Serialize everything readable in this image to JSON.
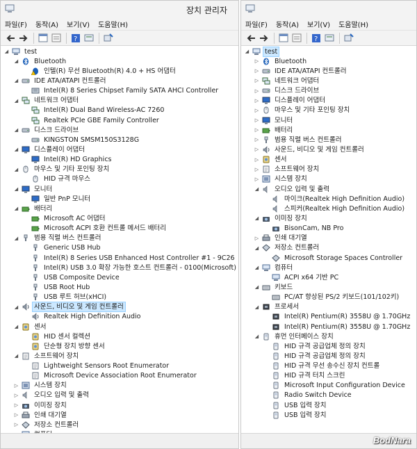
{
  "colors": {
    "selection": "#cce8ff",
    "titlebar": "#f3f3f3"
  },
  "left": {
    "title": "장치 관리자",
    "menu": [
      "파일(F)",
      "동작(A)",
      "보기(V)",
      "도움말(H)"
    ],
    "rows": [
      {
        "d": 0,
        "e": "down",
        "i": "computer",
        "t": "test"
      },
      {
        "d": 1,
        "e": "down",
        "i": "bluetooth",
        "t": "Bluetooth"
      },
      {
        "d": 2,
        "e": "",
        "i": "bluetooth-warn",
        "t": "인텔(R) 무선 Bluetooth(R) 4.0 + HS 어댑터"
      },
      {
        "d": 1,
        "e": "down",
        "i": "disk",
        "t": "IDE ATA/ATAPI 컨트롤러"
      },
      {
        "d": 2,
        "e": "",
        "i": "controller",
        "t": "Intel(R) 8 Series Chipset Family SATA AHCI Controller"
      },
      {
        "d": 1,
        "e": "down",
        "i": "network",
        "t": "네트워크 어댑터"
      },
      {
        "d": 2,
        "e": "",
        "i": "network",
        "t": "Intel(R) Dual Band Wireless-AC 7260"
      },
      {
        "d": 2,
        "e": "",
        "i": "network",
        "t": "Realtek PCIe GBE Family Controller"
      },
      {
        "d": 1,
        "e": "down",
        "i": "disk",
        "t": "디스크 드라이브"
      },
      {
        "d": 2,
        "e": "",
        "i": "disk",
        "t": "KINGSTON SMSM150S3128G"
      },
      {
        "d": 1,
        "e": "down",
        "i": "monitor",
        "t": "디스플레이 어댑터"
      },
      {
        "d": 2,
        "e": "",
        "i": "monitor",
        "t": "Intel(R) HD Graphics"
      },
      {
        "d": 1,
        "e": "down",
        "i": "mouse",
        "t": "마우스 및 기타 포인팅 장치"
      },
      {
        "d": 2,
        "e": "",
        "i": "mouse",
        "t": "HID 규격 마우스"
      },
      {
        "d": 1,
        "e": "down",
        "i": "monitor",
        "t": "모니터"
      },
      {
        "d": 2,
        "e": "",
        "i": "monitor",
        "t": "일반 PnP 모니터"
      },
      {
        "d": 1,
        "e": "down",
        "i": "battery",
        "t": "배터리"
      },
      {
        "d": 2,
        "e": "",
        "i": "battery",
        "t": "Microsoft AC 어댑터"
      },
      {
        "d": 2,
        "e": "",
        "i": "battery",
        "t": "Microsoft ACPI 호환 컨트롤 메서드 배터리"
      },
      {
        "d": 1,
        "e": "down",
        "i": "usb",
        "t": "범용 직렬 버스 컨트롤러"
      },
      {
        "d": 2,
        "e": "",
        "i": "usb",
        "t": "Generic USB Hub"
      },
      {
        "d": 2,
        "e": "",
        "i": "usb",
        "t": "Intel(R) 8 Series USB Enhanced Host Controller #1 - 9C26"
      },
      {
        "d": 2,
        "e": "",
        "i": "usb",
        "t": "Intel(R) USB 3.0 확장 가능한 호스트 컨트롤러 - 0100(Microsoft)"
      },
      {
        "d": 2,
        "e": "",
        "i": "usb",
        "t": "USB Composite Device"
      },
      {
        "d": 2,
        "e": "",
        "i": "usb",
        "t": "USB Root Hub"
      },
      {
        "d": 2,
        "e": "",
        "i": "usb",
        "t": "USB 루트 허브(xHCI)"
      },
      {
        "d": 1,
        "e": "down",
        "i": "speaker",
        "t": "사운드, 비디오 및 게임 컨트롤러",
        "sel": true
      },
      {
        "d": 2,
        "e": "",
        "i": "speaker",
        "t": "Realtek High Definition Audio"
      },
      {
        "d": 1,
        "e": "down",
        "i": "sensor",
        "t": "센서"
      },
      {
        "d": 2,
        "e": "",
        "i": "sensor",
        "t": "HID 센서 컬렉션"
      },
      {
        "d": 2,
        "e": "",
        "i": "sensor",
        "t": "단순형 장치 방향 센서"
      },
      {
        "d": 1,
        "e": "down",
        "i": "software",
        "t": "소프트웨어 장치"
      },
      {
        "d": 2,
        "e": "",
        "i": "software",
        "t": "Lightweight Sensors Root Enumerator"
      },
      {
        "d": 2,
        "e": "",
        "i": "software",
        "t": "Microsoft Device Association Root Enumerator"
      },
      {
        "d": 1,
        "e": "right",
        "i": "system",
        "t": "시스템 장치"
      },
      {
        "d": 1,
        "e": "right",
        "i": "audio",
        "t": "오디오 입력 및 출력"
      },
      {
        "d": 1,
        "e": "right",
        "i": "camera",
        "t": "이미징 장치"
      },
      {
        "d": 1,
        "e": "right",
        "i": "printer",
        "t": "인쇄 대기열"
      },
      {
        "d": 1,
        "e": "right",
        "i": "storage",
        "t": "저장소 컨트롤러"
      },
      {
        "d": 1,
        "e": "right",
        "i": "computer",
        "t": "컴퓨터"
      }
    ]
  },
  "right": {
    "menu": [
      "파일(F)",
      "동작(A)",
      "보기(V)",
      "도움말(H)"
    ],
    "rows": [
      {
        "d": 0,
        "e": "down",
        "i": "computer",
        "t": "test",
        "sel": true
      },
      {
        "d": 1,
        "e": "right",
        "i": "bluetooth",
        "t": "Bluetooth"
      },
      {
        "d": 1,
        "e": "right",
        "i": "disk",
        "t": "IDE ATA/ATAPI 컨트롤러"
      },
      {
        "d": 1,
        "e": "right",
        "i": "network",
        "t": "네트워크 어댑터"
      },
      {
        "d": 1,
        "e": "right",
        "i": "disk",
        "t": "디스크 드라이브"
      },
      {
        "d": 1,
        "e": "right",
        "i": "monitor",
        "t": "디스플레이 어댑터"
      },
      {
        "d": 1,
        "e": "right",
        "i": "mouse",
        "t": "마우스 및 기타 포인팅 장치"
      },
      {
        "d": 1,
        "e": "right",
        "i": "monitor",
        "t": "모니터"
      },
      {
        "d": 1,
        "e": "right",
        "i": "battery",
        "t": "배터리"
      },
      {
        "d": 1,
        "e": "right",
        "i": "usb",
        "t": "범용 직렬 버스 컨트롤러"
      },
      {
        "d": 1,
        "e": "right",
        "i": "speaker",
        "t": "사운드, 비디오 및 게임 컨트롤러"
      },
      {
        "d": 1,
        "e": "right",
        "i": "sensor",
        "t": "센서"
      },
      {
        "d": 1,
        "e": "right",
        "i": "software",
        "t": "소프트웨어 장치"
      },
      {
        "d": 1,
        "e": "right",
        "i": "system",
        "t": "시스템 장치"
      },
      {
        "d": 1,
        "e": "down",
        "i": "audio",
        "t": "오디오 입력 및 출력"
      },
      {
        "d": 2,
        "e": "",
        "i": "audio",
        "t": "마이크(Realtek High Definition Audio)"
      },
      {
        "d": 2,
        "e": "",
        "i": "audio",
        "t": "스피커(Realtek High Definition Audio)"
      },
      {
        "d": 1,
        "e": "down",
        "i": "camera",
        "t": "이미징 장치"
      },
      {
        "d": 2,
        "e": "",
        "i": "camera",
        "t": "BisonCam, NB Pro"
      },
      {
        "d": 1,
        "e": "right",
        "i": "printer",
        "t": "인쇄 대기열"
      },
      {
        "d": 1,
        "e": "down",
        "i": "storage",
        "t": "저장소 컨트롤러"
      },
      {
        "d": 2,
        "e": "",
        "i": "storage",
        "t": "Microsoft Storage Spaces Controller"
      },
      {
        "d": 1,
        "e": "down",
        "i": "computer",
        "t": "컴퓨터"
      },
      {
        "d": 2,
        "e": "",
        "i": "computer",
        "t": "ACPI x64 기반 PC"
      },
      {
        "d": 1,
        "e": "down",
        "i": "keyboard",
        "t": "키보드"
      },
      {
        "d": 2,
        "e": "",
        "i": "keyboard",
        "t": "PC/AT 향상된 PS/2 키보드(101/102키)"
      },
      {
        "d": 1,
        "e": "down",
        "i": "cpu",
        "t": "프로세서"
      },
      {
        "d": 2,
        "e": "",
        "i": "cpu",
        "t": "Intel(R) Pentium(R) 3558U @ 1.70GHz"
      },
      {
        "d": 2,
        "e": "",
        "i": "cpu",
        "t": "Intel(R) Pentium(R) 3558U @ 1.70GHz"
      },
      {
        "d": 1,
        "e": "down",
        "i": "hid",
        "t": "휴먼 인터페이스 장치"
      },
      {
        "d": 2,
        "e": "",
        "i": "hid",
        "t": "HID 규격 공급업체 정의 장치"
      },
      {
        "d": 2,
        "e": "",
        "i": "hid",
        "t": "HID 규격 공급업체 정의 장치"
      },
      {
        "d": 2,
        "e": "",
        "i": "hid",
        "t": "HID 규격 무선 송수신 장치 컨트롤"
      },
      {
        "d": 2,
        "e": "",
        "i": "hid",
        "t": "HID 규격 터치 스크린"
      },
      {
        "d": 2,
        "e": "",
        "i": "hid",
        "t": "Microsoft Input Configuration Device"
      },
      {
        "d": 2,
        "e": "",
        "i": "hid",
        "t": "Radio Switch Device"
      },
      {
        "d": 2,
        "e": "",
        "i": "hid",
        "t": "USB 입력 장치"
      },
      {
        "d": 2,
        "e": "",
        "i": "hid",
        "t": "USB 입력 장치"
      }
    ]
  },
  "watermark": "BodNara"
}
